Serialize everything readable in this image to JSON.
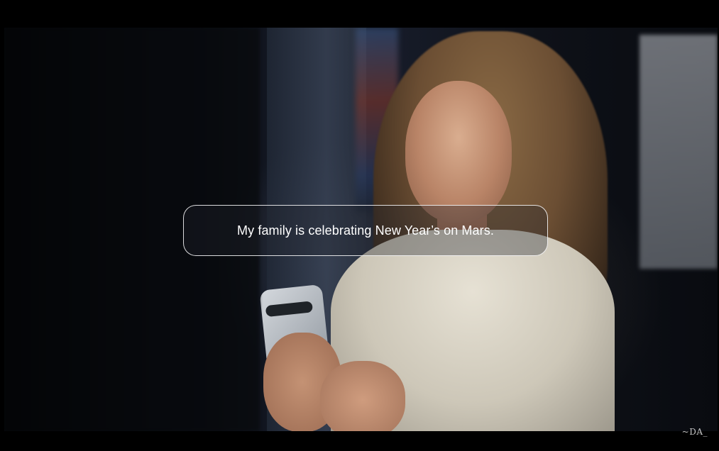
{
  "video": {
    "caption": "My family is celebrating New Year’s on Mars.",
    "watermark": "~DA_"
  },
  "colors": {
    "background": "#000000",
    "caption_text": "#ffffff",
    "caption_border": "#ffffff"
  }
}
